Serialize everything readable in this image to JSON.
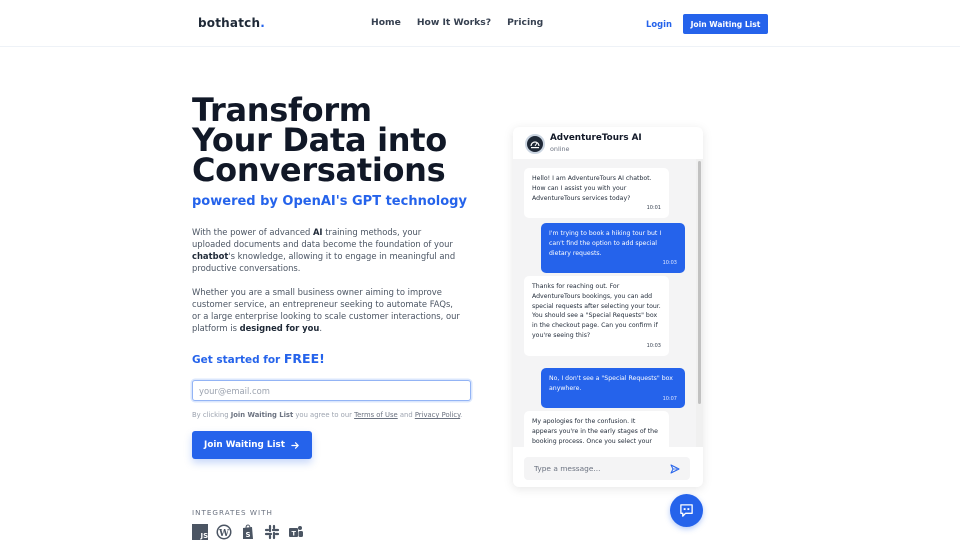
{
  "header": {
    "logo": "bothatch",
    "logo_dot": ".",
    "nav": [
      "Home",
      "How It Works?",
      "Pricing"
    ],
    "login": "Login",
    "cta": "Join Waiting List"
  },
  "hero": {
    "title_lines": [
      "Transform",
      "Your Data into",
      "Conversations"
    ],
    "subtitle": "powered by OpenAI's GPT technology",
    "p1": {
      "a": "With the power of advanced ",
      "b1": "AI",
      "c": " training methods, your uploaded documents and data become the foundation of your ",
      "b2": "chatbot",
      "d": "'s knowledge, allowing it to engage in meaningful and productive conversations."
    },
    "p2": {
      "a": "Whether you are a small business owner aiming to improve customer service, an entrepreneur seeking to automate FAQs, or a large enterprise looking to scale customer interactions, our platform is ",
      "b": "designed for you",
      "c": "."
    },
    "get_started": "Get started for ",
    "free": "FREE!",
    "email_placeholder": "your@email.com",
    "email_value": "",
    "terms": {
      "a": "By clicking ",
      "b": "Join Waiting List",
      "c": " you agree to our ",
      "terms_link": "Terms of Use",
      "d": " and ",
      "privacy_link": "Privacy Policy",
      "e": "."
    },
    "cta": "Join Waiting List",
    "cta_icon": "arrow-right-icon",
    "integrates_label": "INTEGRATES WITH",
    "integrations": [
      "javascript-icon",
      "wordpress-icon",
      "shopify-icon",
      "slack-icon",
      "teams-icon"
    ]
  },
  "chat": {
    "name": "AdventureTours AI",
    "status": "online",
    "messages": [
      {
        "from": "bot",
        "text": "Hello! I am AdventureTours AI chatbot. How can I assist you with your AdventureTours services today?",
        "time": "10:01"
      },
      {
        "from": "user",
        "text": "I'm trying to book a hiking tour but I can't find the option to add special dietary requests.",
        "time": "10:03"
      },
      {
        "from": "bot",
        "text": "Thanks for reaching out. For AdventureTours bookings, you can add special requests after selecting your tour. You should see a \"Special Requests\" box in the checkout page. Can you confirm if you're seeing this?",
        "time": "10:03"
      },
      {
        "from": "user",
        "text": "No, I don't see a \"Special Requests\" box anywhere.",
        "time": "10:07"
      },
      {
        "from": "bot",
        "text": "My apologies for the confusion. It appears you're in the early stages of the booking process. Once you select your hiking tour and proceed to the \"Personal",
        "time": ""
      }
    ],
    "input_placeholder": "Type a message...",
    "brand_color": "#2563eb"
  }
}
